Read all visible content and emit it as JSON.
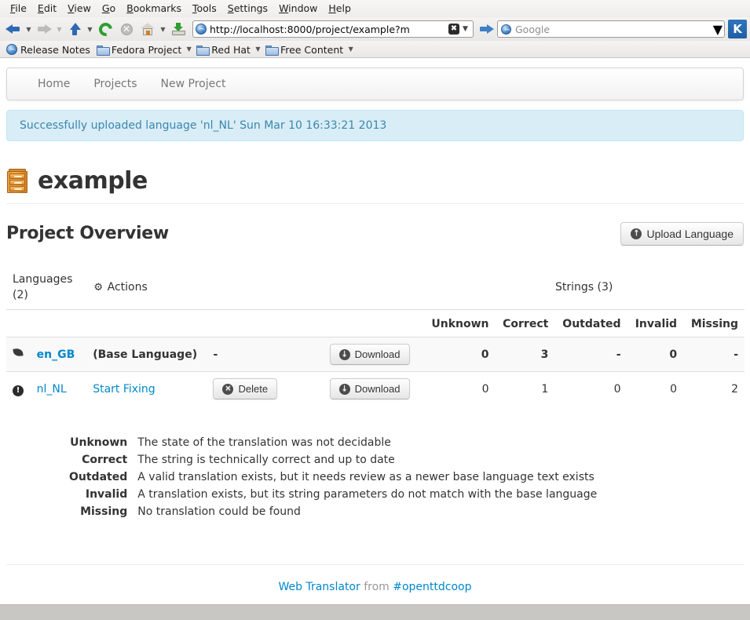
{
  "browser": {
    "menus": [
      {
        "label": "File",
        "accel": "F"
      },
      {
        "label": "Edit",
        "accel": "E"
      },
      {
        "label": "View",
        "accel": "V"
      },
      {
        "label": "Go",
        "accel": "G"
      },
      {
        "label": "Bookmarks",
        "accel": "B"
      },
      {
        "label": "Tools",
        "accel": "T"
      },
      {
        "label": "Settings",
        "accel": "S"
      },
      {
        "label": "Window",
        "accel": "W"
      },
      {
        "label": "Help",
        "accel": "H"
      }
    ],
    "toolbar": {
      "back": "back-arrow-icon",
      "forward": "forward-arrow-icon",
      "up": "up-arrow-icon",
      "reload": "reload-icon",
      "stop": "stop-icon",
      "home": "home-icon",
      "save": "save-icon",
      "go": "go-arrow-icon"
    },
    "url": "http://localhost:8000/project/example?m",
    "search_placeholder": "Google",
    "kde_logo": "K",
    "bookmarks": [
      {
        "label": "Release Notes",
        "icon": "globe-icon",
        "dropdown": false
      },
      {
        "label": "Fedora Project",
        "icon": "folder-icon",
        "dropdown": true
      },
      {
        "label": "Red Hat",
        "icon": "folder-icon",
        "dropdown": true
      },
      {
        "label": "Free Content",
        "icon": "folder-icon",
        "dropdown": true
      }
    ]
  },
  "nav": {
    "items": [
      {
        "label": "Home"
      },
      {
        "label": "Projects"
      },
      {
        "label": "New Project"
      }
    ]
  },
  "alert": {
    "message": "Successfully uploaded language 'nl_NL' Sun Mar 10 16:33:21 2013"
  },
  "header": {
    "title": "example",
    "icon": "filing-cabinet-icon"
  },
  "overview": {
    "title": "Project Overview",
    "upload_button": "Upload Language",
    "upload_icon": "↑"
  },
  "table": {
    "group_headers": {
      "languages": "Languages (2)",
      "actions": "Actions",
      "actions_icon": "⚙",
      "strings": "Strings (3)"
    },
    "columns": [
      "Unknown",
      "Correct",
      "Outdated",
      "Invalid",
      "Missing"
    ],
    "rows": [
      {
        "status_icon": "leaf-icon",
        "language": "en_GB",
        "base_label": "(Base Language)",
        "fix_label": "-",
        "delete_label": null,
        "download_label": "Download",
        "counts": [
          "0",
          "3",
          "-",
          "0",
          "-"
        ],
        "is_base": true
      },
      {
        "status_icon": "exclamation-circle-icon",
        "language": "nl_NL",
        "base_label": "Start Fixing",
        "fix_label": null,
        "delete_label": "Delete",
        "download_label": "Download",
        "counts": [
          "0",
          "1",
          "0",
          "0",
          "2"
        ],
        "is_base": false
      }
    ],
    "download_icon": "↓",
    "delete_icon": "✕"
  },
  "legend": [
    {
      "key": "Unknown",
      "desc": "The state of the translation was not decidable"
    },
    {
      "key": "Correct",
      "desc": "The string is technically correct and up to date"
    },
    {
      "key": "Outdated",
      "desc": "A valid translation exists, but it needs review as a newer base language text exists"
    },
    {
      "key": "Invalid",
      "desc": "A translation exists, but its string parameters do not match with the base language"
    },
    {
      "key": "Missing",
      "desc": "No translation could be found"
    }
  ],
  "footer": {
    "app": "Web Translator",
    "middle": "from",
    "channel": "#openttdcoop"
  },
  "colors": {
    "link": "#0088cc",
    "alert_bg": "#d9edf7",
    "alert_border": "#bce8f1",
    "alert_text": "#3a87ad",
    "accent_orange": "#f0ad4e"
  }
}
